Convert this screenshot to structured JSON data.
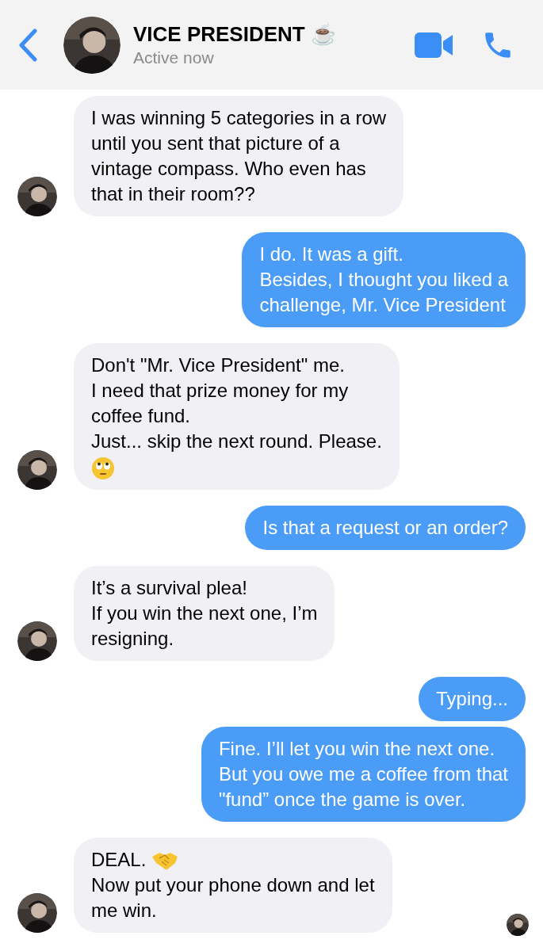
{
  "header": {
    "title": "VICE PRESIDENT ☕",
    "status": "Active now"
  },
  "messages": [
    {
      "kind": "received",
      "parts": [
        {
          "kind": "text",
          "text": "I was winning 5 categories in a row\nuntil you sent that picture of a\nvintage compass. Who even has\nthat in their room??"
        }
      ]
    },
    {
      "kind": "sent",
      "parts": [
        {
          "kind": "text",
          "text": "I do. It was a gift.\nBesides, I thought you liked a\nchallenge, Mr. Vice President"
        }
      ]
    },
    {
      "kind": "received",
      "parts": [
        {
          "kind": "text",
          "text": "Don't \"Mr. Vice President\" me.\nI need that prize money for my\ncoffee fund.\nJust... skip the next round. Please.\n"
        },
        {
          "kind": "eyeroll"
        }
      ]
    },
    {
      "kind": "sent",
      "parts": [
        {
          "kind": "text",
          "text": "Is that a request or an order?"
        }
      ]
    },
    {
      "kind": "received",
      "parts": [
        {
          "kind": "text",
          "text": "It’s a survival plea!\nIf you win the next one, I’m\nresigning."
        }
      ]
    },
    {
      "kind": "sent",
      "parts": [
        {
          "kind": "text",
          "text": "Typing..."
        }
      ]
    },
    {
      "kind": "sent",
      "parts": [
        {
          "kind": "text",
          "text": "Fine. I’ll let you win the next one.\nBut you owe me a coffee from that\n\"fund” once the game is over."
        }
      ]
    },
    {
      "kind": "received",
      "parts": [
        {
          "kind": "text",
          "text": "DEAL. "
        },
        {
          "kind": "handshake"
        },
        {
          "kind": "text",
          "text": "\nNow put your phone down and let\nme win."
        }
      ]
    }
  ]
}
